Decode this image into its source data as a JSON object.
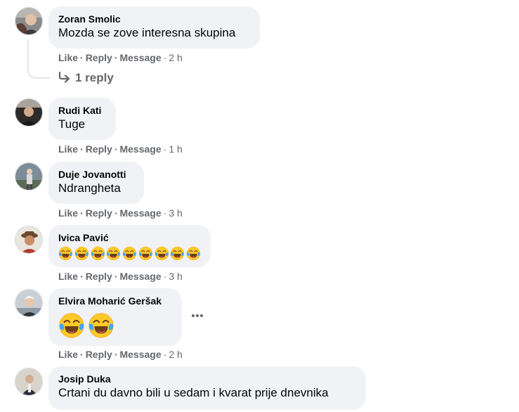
{
  "comments": [
    {
      "author": "Zoran Smolic",
      "text": "Mozda se zove interesna skupina",
      "like": "Like",
      "reply": "Reply",
      "message": "Message",
      "time": "2 h",
      "replies_link": "1 reply"
    },
    {
      "author": "Rudi Kati",
      "text": "Tuge",
      "like": "Like",
      "reply": "Reply",
      "message": "Message",
      "time": "1 h"
    },
    {
      "author": "Duje Jovanotti",
      "text": "Ndrangheta",
      "like": "Like",
      "reply": "Reply",
      "message": "Message",
      "time": "3 h"
    },
    {
      "author": "Ivica Pavić",
      "emoji_count": 9,
      "emoji": "face-with-tears-of-joy",
      "like": "Like",
      "reply": "Reply",
      "message": "Message",
      "time": "3 h"
    },
    {
      "author": "Elvira Moharić Geršak",
      "emoji_count": 2,
      "emoji": "face-with-tears-of-joy",
      "like": "Like",
      "reply": "Reply",
      "message": "Message",
      "time": "2 h"
    },
    {
      "author": "Josip Duka",
      "text": "Crtani du davno bili u sedam i kvarat prije dnevnika"
    }
  ],
  "colors": {
    "bubble": "#f0f2f5",
    "meta": "#65676b",
    "text": "#050505",
    "emoji_face": "#ffca28",
    "emoji_tear": "#42a5f5"
  },
  "icons": {
    "reply_arrow": "reply-arrow-icon",
    "more": "more-options-icon"
  }
}
